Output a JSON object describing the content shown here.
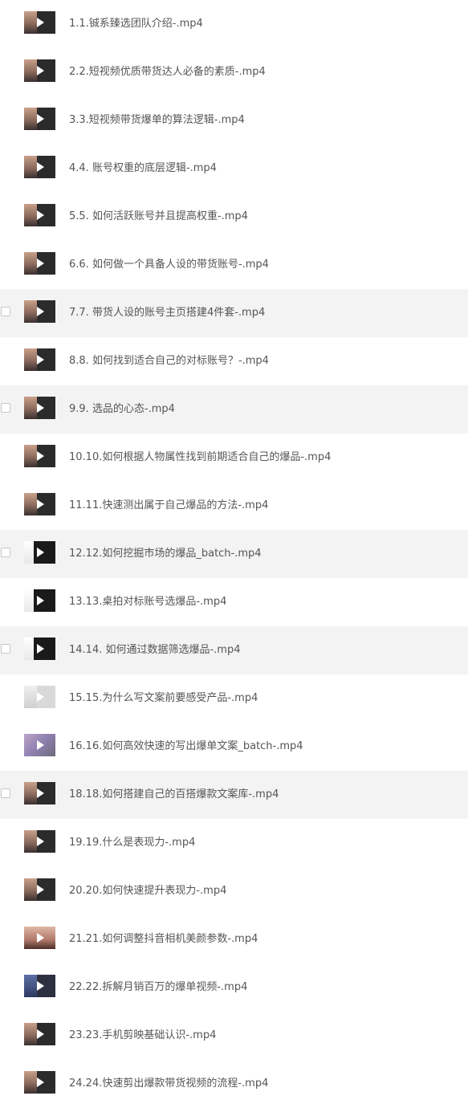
{
  "files": [
    {
      "name": "1.1.铖系臻选团队介绍-.mp4",
      "selected": false,
      "highlighted": false,
      "thumb": "default"
    },
    {
      "name": "2.2.短视频优质带货达人必备的素质-.mp4",
      "selected": false,
      "highlighted": false,
      "thumb": "default"
    },
    {
      "name": "3.3.短视频带货爆单的算法逻辑-.mp4",
      "selected": false,
      "highlighted": false,
      "thumb": "default"
    },
    {
      "name": "4.4. 账号权重的底层逻辑-.mp4",
      "selected": false,
      "highlighted": false,
      "thumb": "default"
    },
    {
      "name": "5.5. 如何活跃账号并且提高权重-.mp4",
      "selected": false,
      "highlighted": false,
      "thumb": "default"
    },
    {
      "name": "6.6. 如何做一个具备人设的带货账号-.mp4",
      "selected": false,
      "highlighted": false,
      "thumb": "default"
    },
    {
      "name": "7.7. 带货人设的账号主页搭建4件套-.mp4",
      "selected": false,
      "highlighted": true,
      "thumb": "default"
    },
    {
      "name": "8.8. 如何找到适合自己的对标账号？-.mp4",
      "selected": false,
      "highlighted": false,
      "thumb": "default"
    },
    {
      "name": "9.9. 选品的心态-.mp4",
      "selected": false,
      "highlighted": true,
      "thumb": "default"
    },
    {
      "name": "10.10.如何根据人物属性找到前期适合自己的爆品-.mp4",
      "selected": false,
      "highlighted": false,
      "thumb": "default"
    },
    {
      "name": "11.11.快速测出属于自己爆品的方法-.mp4",
      "selected": false,
      "highlighted": false,
      "thumb": "default"
    },
    {
      "name": "12.12.如何挖掘市场的爆品_batch-.mp4",
      "selected": false,
      "highlighted": true,
      "thumb": "dark"
    },
    {
      "name": "13.13.桌拍对标账号选爆品-.mp4",
      "selected": false,
      "highlighted": false,
      "thumb": "dark"
    },
    {
      "name": "14.14. 如何通过数据筛选爆品-.mp4",
      "selected": false,
      "highlighted": true,
      "thumb": "dark"
    },
    {
      "name": "15.15.为什么写文案前要感受产品-.mp4",
      "selected": false,
      "highlighted": false,
      "thumb": "light"
    },
    {
      "name": "16.16.如何高效快速的写出爆单文案_batch-.mp4",
      "selected": false,
      "highlighted": false,
      "thumb": "screen"
    },
    {
      "name": "18.18.如何搭建自己的百搭爆款文案库-.mp4",
      "selected": false,
      "highlighted": true,
      "thumb": "default"
    },
    {
      "name": "19.19.什么是表现力-.mp4",
      "selected": false,
      "highlighted": false,
      "thumb": "default"
    },
    {
      "name": "20.20.如何快速提升表现力-.mp4",
      "selected": false,
      "highlighted": false,
      "thumb": "default"
    },
    {
      "name": "21.21.如何调整抖音相机美颜参数-.mp4",
      "selected": false,
      "highlighted": false,
      "thumb": "face"
    },
    {
      "name": "22.22.拆解月销百万的爆单视频-.mp4",
      "selected": false,
      "highlighted": false,
      "thumb": "blue"
    },
    {
      "name": "23.23.手机剪映基础认识-.mp4",
      "selected": false,
      "highlighted": false,
      "thumb": "default"
    },
    {
      "name": "24.24.快速剪出爆款带货视频的流程-.mp4",
      "selected": false,
      "highlighted": false,
      "thumb": "default"
    }
  ],
  "icons": {
    "thumbnail": "video-thumbnail-icon",
    "play": "play-icon",
    "checkbox": "checkbox-icon"
  },
  "colors": {
    "row_highlight": "#f3f3f3",
    "text": "#555555"
  }
}
